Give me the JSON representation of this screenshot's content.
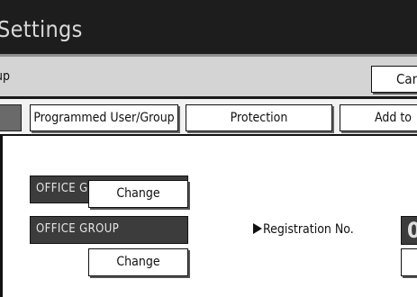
{
  "header": {
    "title": "Settings"
  },
  "subheader": {
    "label": "up",
    "cancel_label": "Can"
  },
  "tabs": [
    {
      "label": ""
    },
    {
      "label": "Programmed User/Group"
    },
    {
      "label": "Protection"
    },
    {
      "label": "Add to"
    }
  ],
  "groups": [
    {
      "name": "OFFICE GROUP",
      "button_label": "Change"
    },
    {
      "name": "OFFICE GROUP",
      "button_label": "Change"
    }
  ],
  "registration": {
    "label": "Registration No.",
    "value": "0"
  },
  "colors": {
    "title_bar": "#1d1d1d",
    "subheader": "#d4d4d4",
    "field_dark": "#3c3c3c"
  }
}
